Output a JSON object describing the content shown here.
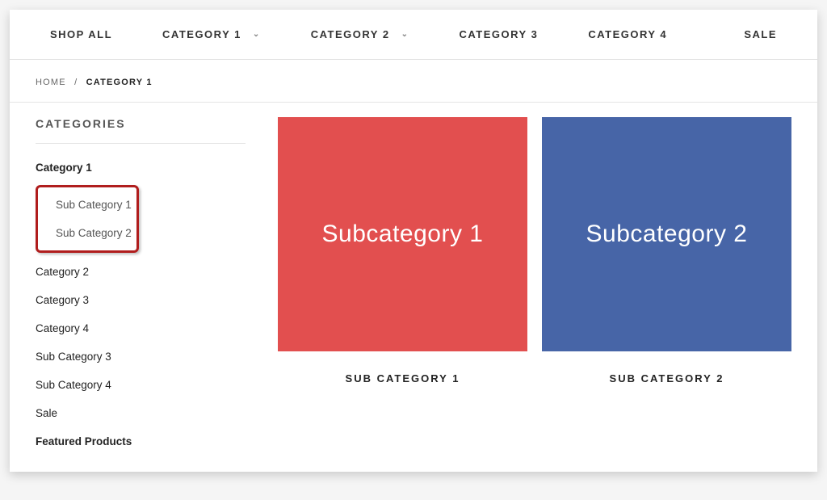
{
  "nav": {
    "shop_all": "SHOP ALL",
    "cat1": "CATEGORY 1",
    "cat2": "CATEGORY 2",
    "cat3": "CATEGORY 3",
    "cat4": "CATEGORY 4",
    "sale": "SALE"
  },
  "breadcrumb": {
    "home": "HOME",
    "sep": "/",
    "current": "CATEGORY 1"
  },
  "sidebar": {
    "heading": "CATEGORIES",
    "items": {
      "cat1": "Category 1",
      "sub1": "Sub Category 1",
      "sub2": "Sub Category 2",
      "cat2": "Category 2",
      "cat3": "Category 3",
      "cat4": "Category 4",
      "sub3": "Sub Category 3",
      "sub4": "Sub Category 4",
      "sale": "Sale",
      "featured": "Featured Products"
    }
  },
  "tiles": {
    "t1": {
      "img_text": "Subcategory 1",
      "label": "SUB CATEGORY 1",
      "color": "#e24f4f"
    },
    "t2": {
      "img_text": "Subcategory 2",
      "label": "SUB CATEGORY 2",
      "color": "#4765a7"
    }
  }
}
